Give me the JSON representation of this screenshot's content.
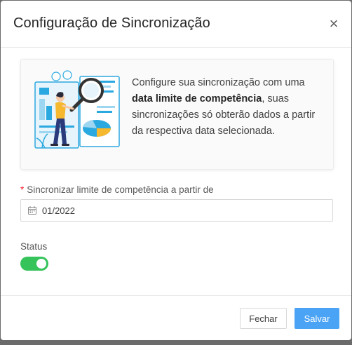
{
  "modal": {
    "title": "Configuração de Sincronização",
    "close_glyph": "×"
  },
  "info": {
    "text_before": "Configure sua sincronização com uma ",
    "text_bold": "data limite de competência",
    "text_after": ", suas sincronizações só obterão dados a partir da respectiva data selecionada.",
    "illustration": "analytics-illustration"
  },
  "form": {
    "required_mark": "*",
    "competence_label": "Sincronizar limite de competência a partir de",
    "competence_value": "01/2022",
    "calendar_icon": "calendar-icon",
    "status_label": "Status",
    "status_enabled": true
  },
  "footer": {
    "cancel_label": "Fechar",
    "save_label": "Salvar"
  },
  "colors": {
    "accent": "#4aa3f5",
    "toggle_on": "#35c35a",
    "required": "#f5222d",
    "illustration_blue": "#2aa8e0",
    "illustration_yellow": "#f5b82e"
  }
}
